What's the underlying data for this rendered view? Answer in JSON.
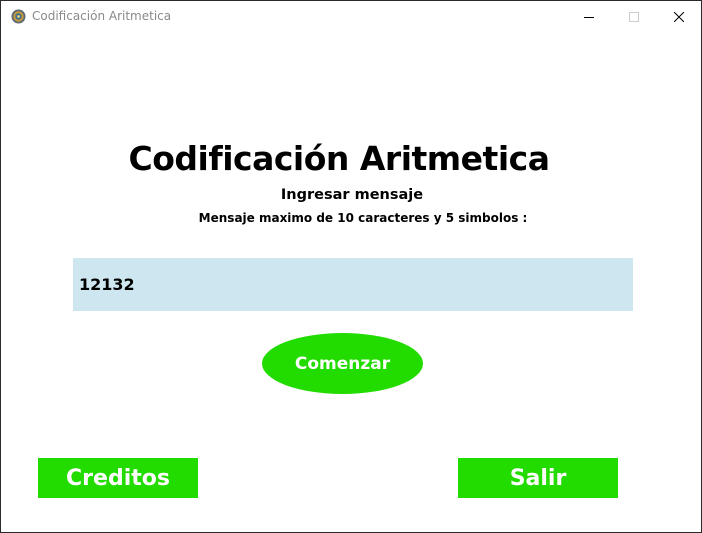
{
  "window": {
    "title": "Codificación Aritmetica"
  },
  "main": {
    "heading": "Codificación Aritmetica",
    "subheading": "Ingresar mensaje",
    "note": "Mensaje maximo de 10 caracteres y 5 simbolos :",
    "message_value": "12132",
    "start_label": "Comenzar",
    "credits_label": "Creditos",
    "exit_label": "Salir"
  },
  "colors": {
    "button_green": "#22dc00",
    "input_background": "#cde6ef"
  },
  "icons": {
    "app": "app-globe-icon",
    "minimize": "minimize-icon",
    "maximize": "maximize-icon",
    "close": "close-icon"
  }
}
